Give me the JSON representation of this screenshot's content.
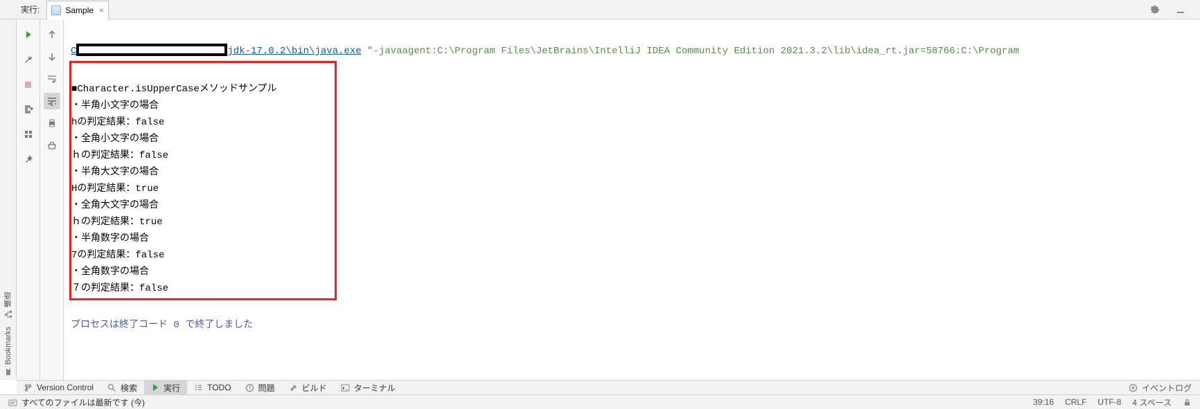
{
  "header": {
    "run_label": "実行:",
    "tab_name": "Sample",
    "tab_close": "×"
  },
  "console": {
    "cmd_prefix": "C",
    "jdk_path": "jdk-17.0.2\\bin\\java.exe",
    "cmd_args": " \"-javaagent:C:\\Program Files\\JetBrains\\IntelliJ IDEA Community Edition 2021.3.2\\lib\\idea_rt.jar=58766:C:\\Program",
    "output": [
      "■Character.isUpperCaseメソッドサンプル",
      "・半角小文字の場合",
      "hの判定結果：false",
      "・全角小文字の場合",
      "ｈの判定結果：false",
      "・半角大文字の場合",
      "Hの判定結果：true",
      "・全角大文字の場合",
      "ｈの判定結果：true",
      "・半角数字の場合",
      "7の判定結果：false",
      "・全角数字の場合",
      "７の判定結果：false"
    ],
    "process_exit": "プロセスは終了コード 0 で終了しました"
  },
  "left_side": {
    "structure": "構造",
    "bookmarks": "Bookmarks"
  },
  "bottom_tabs": {
    "version_control": "Version Control",
    "search": "検索",
    "run": "実行",
    "todo": "TODO",
    "problems": "問題",
    "build": "ビルド",
    "terminal": "ターミナル",
    "event_log": "イベントログ"
  },
  "status": {
    "message": "すべてのファイルは最新です (今)",
    "line_col": "39:16",
    "line_ending": "CRLF",
    "encoding": "UTF-8",
    "indent": "4 スペース"
  }
}
